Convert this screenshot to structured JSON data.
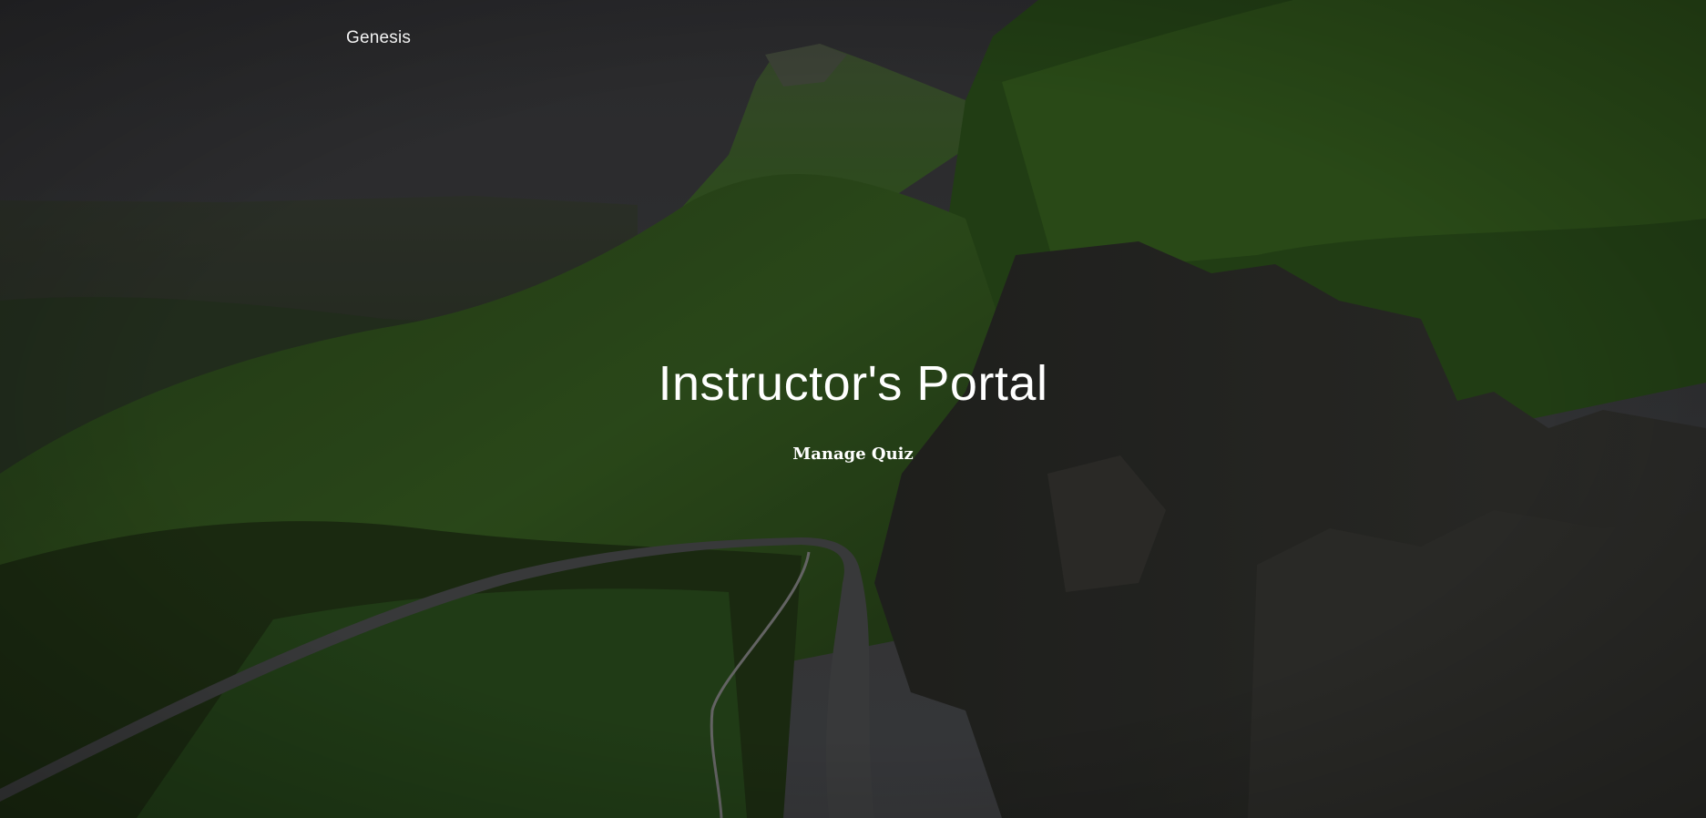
{
  "nav": {
    "brand": "Genesis"
  },
  "hero": {
    "title": "Instructor's Portal",
    "cta_label": "Manage Quiz",
    "background": "mountain-road-landscape"
  },
  "colors": {
    "sky": "#3f3f43",
    "grass": "#2f4a1f",
    "rock": "#2a2a28",
    "road": "#4c4c4e",
    "text": "#ffffff"
  }
}
